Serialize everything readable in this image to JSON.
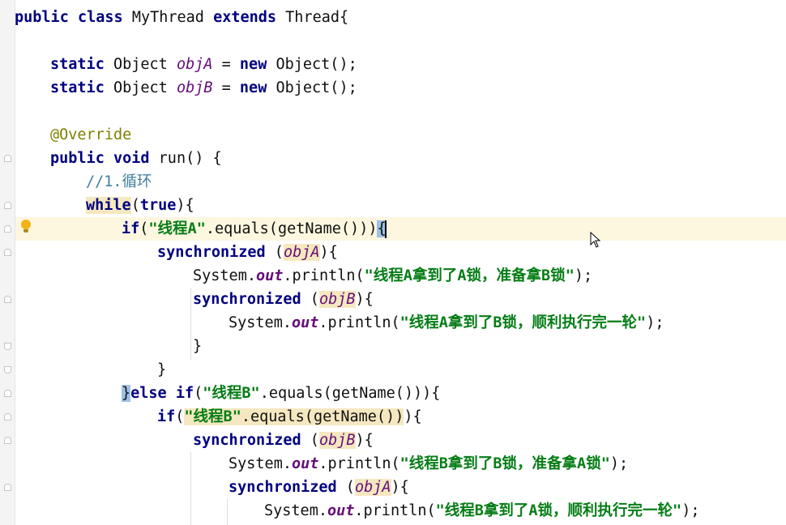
{
  "editor": {
    "language": "Java",
    "lines": {
      "l1": {
        "kw_public": "public",
        "kw_class": "class",
        "name": "MyThread",
        "kw_extends": "extends",
        "rest": "Thread{"
      },
      "l3": {
        "kw_static": "static",
        "type": "Object",
        "field": "objA",
        "eq": " = ",
        "kw_new": "new",
        "rest": "Object();"
      },
      "l4": {
        "kw_static": "static",
        "type": "Object",
        "field": "objB",
        "eq": " = ",
        "kw_new": "new",
        "rest": "Object();"
      },
      "l6": {
        "annotation": "@Override"
      },
      "l7": {
        "kw_public": "public",
        "kw_void": "void",
        "rest": "run() {"
      },
      "l8": {
        "comment": "//1.循环"
      },
      "l9": {
        "kw_while": "while",
        "open": "(",
        "kw_true": "true",
        "rest": "){"
      },
      "l10": {
        "kw_if": "if",
        "open": "(",
        "string": "\"线程A\"",
        "mid": ".equals(getName()))",
        "brace": "{"
      },
      "l11": {
        "kw_sync": "synchronized",
        "open": " (",
        "field": "objA",
        "rest": "){"
      },
      "l12": {
        "pre": "System.",
        "sfield": "out",
        "mid": ".println(",
        "string": "\"线程A拿到了A锁，准备拿B锁\"",
        "rest": ");"
      },
      "l13": {
        "kw_sync": "synchronized",
        "open": " (",
        "field": "objB",
        "rest": "){"
      },
      "l14": {
        "pre": "System.",
        "sfield": "out",
        "mid": ".println(",
        "string": "\"线程A拿到了B锁，顺利执行完一轮\"",
        "rest": ");"
      },
      "l15": {
        "rest": "}"
      },
      "l16": {
        "rest": "}"
      },
      "l17": {
        "brace": "}",
        "kw_else": "else",
        "kw_if": "if",
        "open": "(",
        "string": "\"线程B\"",
        "rest": ".equals(getName())){"
      },
      "l18": {
        "kw_if": "if",
        "open": "(",
        "string": "\"线程B\"",
        "mid": ".equals(getName())",
        "rest": "){"
      },
      "l19": {
        "kw_sync": "synchronized",
        "open": " (",
        "field": "objB",
        "rest": "){"
      },
      "l20": {
        "pre": "System.",
        "sfield": "out",
        "mid": ".println(",
        "string": "\"线程B拿到了B锁，准备拿A锁\"",
        "rest": ");"
      },
      "l21": {
        "kw_sync": "synchronized",
        "open": " (",
        "field": "objA",
        "rest": "){"
      },
      "l22": {
        "pre": "System.",
        "sfield": "out",
        "mid": ".println(",
        "string": "\"线程B拿到了A锁，顺利执行完一轮\"",
        "rest": ");"
      }
    },
    "gutter_icons": [
      "intention-bulb-icon"
    ],
    "colors": {
      "keyword": "#000080",
      "string": "#067d17",
      "field": "#660e7a",
      "comment": "#41809c",
      "annotation": "#808000",
      "current_line": "#fdf7e0"
    }
  }
}
